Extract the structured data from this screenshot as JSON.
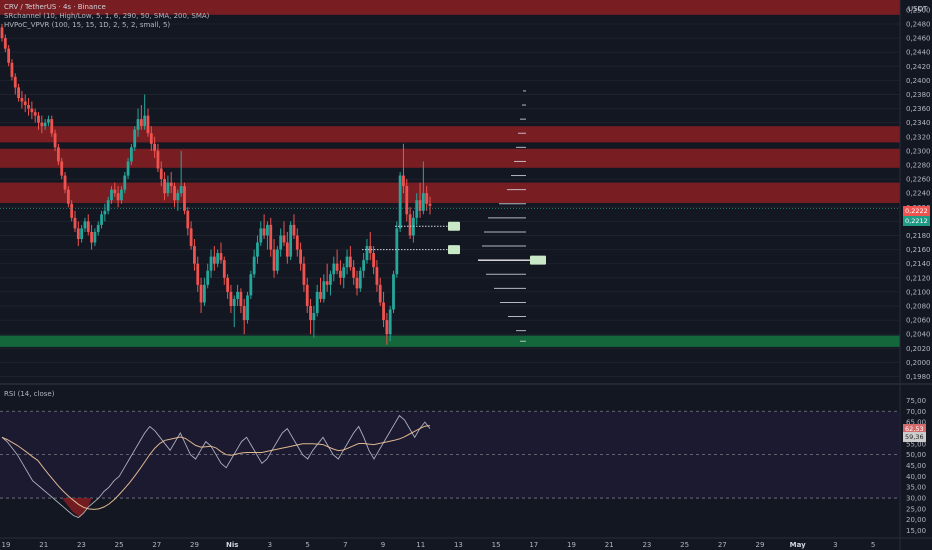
{
  "header": {
    "symbol_line": "CRV / TetherUS · 4s · Binance",
    "indicator_1": "SRchannel (10, High/Low, 5, 1, 6, 290, 50, SMA, 200, SMA)",
    "indicator_2": "HVPoC_VPVR (100, 15, 15, 1D, 2, 5, 2, small, 5)"
  },
  "currency": "USDT",
  "rsi": {
    "title": "RSI (14, close)",
    "ticks": [
      "75,00",
      "70,00",
      "65,00",
      "60,00",
      "55,00",
      "50,00",
      "45,00",
      "40,00",
      "35,00",
      "30,00",
      "25,00",
      "20,00",
      "15,00"
    ],
    "upper_band": 70,
    "lower_band": 30,
    "badge_rsi": "62,53",
    "badge_ma": "59,36"
  },
  "price_badges": {
    "last_red": "0,2222",
    "last_green": "0,2212"
  },
  "colors": {
    "background": "#131722",
    "bull": "#26a69a",
    "bear": "#ef5350",
    "resistance_zone": "#8b1e22",
    "support_zone": "#136b3d",
    "rsi_line": "#d1d4dc",
    "rsi_ma": "#f5c99a"
  },
  "chart_data": {
    "type": "candlestick",
    "y_ticks": [
      "0,2500",
      "0,2480",
      "0,2460",
      "0,2440",
      "0,2420",
      "0,2400",
      "0,2380",
      "0,2360",
      "0,2340",
      "0,2320",
      "0,2300",
      "0,2280",
      "0,2260",
      "0,2240",
      "0,2220",
      "0,2200",
      "0,2180",
      "0,2160",
      "0,2140",
      "0,2120",
      "0,2100",
      "0,2080",
      "0,2060",
      "0,2040",
      "0,2020",
      "0,2000",
      "0,1980"
    ],
    "ylim": [
      0.1975,
      0.2514
    ],
    "x_ticks": [
      "19",
      "21",
      "23",
      "25",
      "27",
      "29",
      "Nis",
      "3",
      "5",
      "7",
      "9",
      "11",
      "13",
      "15",
      "17",
      "19",
      "21",
      "23",
      "25",
      "27",
      "29",
      "May",
      "3",
      "5"
    ],
    "resistance_zones": [
      [
        0.2493,
        0.2514
      ],
      [
        0.2312,
        0.2335
      ],
      [
        0.2276,
        0.2303
      ],
      [
        0.2226,
        0.2255
      ]
    ],
    "support_zones": [
      [
        0.2022,
        0.2038
      ]
    ],
    "ohlc": [
      [
        0.2475,
        0.248,
        0.2455,
        0.246
      ],
      [
        0.246,
        0.2465,
        0.244,
        0.2445
      ],
      [
        0.2445,
        0.245,
        0.242,
        0.2425
      ],
      [
        0.2425,
        0.243,
        0.24,
        0.2405
      ],
      [
        0.2405,
        0.241,
        0.238,
        0.239
      ],
      [
        0.239,
        0.2395,
        0.237,
        0.2375
      ],
      [
        0.2375,
        0.2385,
        0.236,
        0.237
      ],
      [
        0.237,
        0.238,
        0.2355,
        0.2365
      ],
      [
        0.2365,
        0.2375,
        0.235,
        0.236
      ],
      [
        0.236,
        0.237,
        0.2345,
        0.2355
      ],
      [
        0.2355,
        0.236,
        0.234,
        0.235
      ],
      [
        0.235,
        0.2355,
        0.233,
        0.234
      ],
      [
        0.234,
        0.235,
        0.2325,
        0.2335
      ],
      [
        0.2335,
        0.2345,
        0.233,
        0.234
      ],
      [
        0.234,
        0.235,
        0.2335,
        0.2345
      ],
      [
        0.2345,
        0.235,
        0.232,
        0.2325
      ],
      [
        0.2325,
        0.233,
        0.23,
        0.2305
      ],
      [
        0.2305,
        0.231,
        0.228,
        0.2285
      ],
      [
        0.2285,
        0.229,
        0.226,
        0.2265
      ],
      [
        0.2265,
        0.227,
        0.224,
        0.2245
      ],
      [
        0.2245,
        0.225,
        0.222,
        0.2225
      ],
      [
        0.2225,
        0.223,
        0.22,
        0.2205
      ],
      [
        0.2205,
        0.2215,
        0.2185,
        0.219
      ],
      [
        0.219,
        0.22,
        0.2165,
        0.2175
      ],
      [
        0.2175,
        0.2195,
        0.217,
        0.219
      ],
      [
        0.219,
        0.2205,
        0.2185,
        0.22
      ],
      [
        0.22,
        0.221,
        0.218,
        0.2185
      ],
      [
        0.2185,
        0.2195,
        0.216,
        0.217
      ],
      [
        0.217,
        0.219,
        0.2165,
        0.2185
      ],
      [
        0.2185,
        0.22,
        0.218,
        0.2195
      ],
      [
        0.2195,
        0.2215,
        0.219,
        0.221
      ],
      [
        0.221,
        0.2225,
        0.22,
        0.2215
      ],
      [
        0.2215,
        0.2235,
        0.221,
        0.223
      ],
      [
        0.223,
        0.225,
        0.2225,
        0.2245
      ],
      [
        0.2245,
        0.2255,
        0.2235,
        0.224
      ],
      [
        0.224,
        0.225,
        0.222,
        0.223
      ],
      [
        0.223,
        0.225,
        0.2225,
        0.2245
      ],
      [
        0.2245,
        0.227,
        0.224,
        0.2265
      ],
      [
        0.2265,
        0.229,
        0.226,
        0.2285
      ],
      [
        0.2285,
        0.231,
        0.228,
        0.2305
      ],
      [
        0.2305,
        0.2335,
        0.23,
        0.233
      ],
      [
        0.233,
        0.236,
        0.232,
        0.2345
      ],
      [
        0.2345,
        0.2365,
        0.233,
        0.2335
      ],
      [
        0.2335,
        0.238,
        0.233,
        0.235
      ],
      [
        0.235,
        0.236,
        0.232,
        0.2325
      ],
      [
        0.2325,
        0.2335,
        0.23,
        0.231
      ],
      [
        0.231,
        0.232,
        0.229,
        0.23
      ],
      [
        0.23,
        0.231,
        0.227,
        0.2275
      ],
      [
        0.2275,
        0.2285,
        0.225,
        0.226
      ],
      [
        0.226,
        0.227,
        0.223,
        0.224
      ],
      [
        0.224,
        0.2265,
        0.2235,
        0.2255
      ],
      [
        0.2255,
        0.227,
        0.224,
        0.225
      ],
      [
        0.225,
        0.2255,
        0.222,
        0.223
      ],
      [
        0.223,
        0.2245,
        0.2215,
        0.224
      ],
      [
        0.224,
        0.23,
        0.2235,
        0.225
      ],
      [
        0.225,
        0.2255,
        0.221,
        0.2215
      ],
      [
        0.2215,
        0.222,
        0.218,
        0.219
      ],
      [
        0.219,
        0.22,
        0.216,
        0.2165
      ],
      [
        0.2165,
        0.2175,
        0.213,
        0.214
      ],
      [
        0.214,
        0.215,
        0.21,
        0.211
      ],
      [
        0.211,
        0.212,
        0.207,
        0.2085
      ],
      [
        0.2085,
        0.212,
        0.208,
        0.211
      ],
      [
        0.211,
        0.214,
        0.2105,
        0.213
      ],
      [
        0.213,
        0.216,
        0.212,
        0.215
      ],
      [
        0.215,
        0.2165,
        0.213,
        0.214
      ],
      [
        0.214,
        0.216,
        0.2135,
        0.2155
      ],
      [
        0.2155,
        0.217,
        0.214,
        0.2145
      ],
      [
        0.2145,
        0.215,
        0.211,
        0.212
      ],
      [
        0.212,
        0.2125,
        0.209,
        0.21
      ],
      [
        0.21,
        0.211,
        0.207,
        0.208
      ],
      [
        0.208,
        0.2095,
        0.205,
        0.209
      ],
      [
        0.209,
        0.211,
        0.208,
        0.21
      ],
      [
        0.21,
        0.2105,
        0.207,
        0.208
      ],
      [
        0.208,
        0.209,
        0.204,
        0.206
      ],
      [
        0.206,
        0.21,
        0.2055,
        0.2095
      ],
      [
        0.2095,
        0.213,
        0.209,
        0.2125
      ],
      [
        0.2125,
        0.216,
        0.212,
        0.215
      ],
      [
        0.215,
        0.218,
        0.214,
        0.217
      ],
      [
        0.217,
        0.22,
        0.2165,
        0.219
      ],
      [
        0.219,
        0.221,
        0.2175,
        0.218
      ],
      [
        0.218,
        0.22,
        0.216,
        0.2195
      ],
      [
        0.2195,
        0.2205,
        0.215,
        0.216
      ],
      [
        0.216,
        0.2175,
        0.212,
        0.213
      ],
      [
        0.213,
        0.2165,
        0.2125,
        0.216
      ],
      [
        0.216,
        0.219,
        0.215,
        0.218
      ],
      [
        0.218,
        0.22,
        0.2165,
        0.217
      ],
      [
        0.217,
        0.2185,
        0.214,
        0.215
      ],
      [
        0.215,
        0.22,
        0.2145,
        0.2195
      ],
      [
        0.2195,
        0.221,
        0.2175,
        0.218
      ],
      [
        0.218,
        0.219,
        0.215,
        0.216
      ],
      [
        0.216,
        0.217,
        0.213,
        0.214
      ],
      [
        0.214,
        0.215,
        0.21,
        0.211
      ],
      [
        0.211,
        0.212,
        0.207,
        0.208
      ],
      [
        0.208,
        0.209,
        0.204,
        0.206
      ],
      [
        0.206,
        0.208,
        0.2035,
        0.207
      ],
      [
        0.207,
        0.211,
        0.2065,
        0.21
      ],
      [
        0.21,
        0.212,
        0.2085,
        0.209
      ],
      [
        0.209,
        0.2125,
        0.2085,
        0.2115
      ],
      [
        0.2115,
        0.214,
        0.21,
        0.211
      ],
      [
        0.211,
        0.213,
        0.2095,
        0.2125
      ],
      [
        0.2125,
        0.215,
        0.2115,
        0.214
      ],
      [
        0.214,
        0.216,
        0.2125,
        0.213
      ],
      [
        0.213,
        0.2145,
        0.211,
        0.212
      ],
      [
        0.212,
        0.214,
        0.2105,
        0.2135
      ],
      [
        0.2135,
        0.216,
        0.2125,
        0.215
      ],
      [
        0.215,
        0.2165,
        0.213,
        0.2135
      ],
      [
        0.2135,
        0.2145,
        0.211,
        0.212
      ],
      [
        0.212,
        0.213,
        0.2095,
        0.2105
      ],
      [
        0.2105,
        0.2135,
        0.21,
        0.213
      ],
      [
        0.213,
        0.2155,
        0.212,
        0.2145
      ],
      [
        0.2145,
        0.2175,
        0.214,
        0.2165
      ],
      [
        0.2165,
        0.2185,
        0.2145,
        0.2155
      ],
      [
        0.2155,
        0.2165,
        0.2125,
        0.2135
      ],
      [
        0.2135,
        0.2145,
        0.21,
        0.211
      ],
      [
        0.211,
        0.212,
        0.208,
        0.2085
      ],
      [
        0.2085,
        0.21,
        0.205,
        0.206
      ],
      [
        0.206,
        0.207,
        0.2025,
        0.204
      ],
      [
        0.204,
        0.208,
        0.203,
        0.2075
      ],
      [
        0.2075,
        0.213,
        0.207,
        0.2125
      ],
      [
        0.2125,
        0.22,
        0.212,
        0.219
      ],
      [
        0.219,
        0.227,
        0.2185,
        0.2265
      ],
      [
        0.2265,
        0.231,
        0.224,
        0.225
      ],
      [
        0.225,
        0.226,
        0.22,
        0.221
      ],
      [
        0.221,
        0.222,
        0.2175,
        0.218
      ],
      [
        0.218,
        0.2215,
        0.217,
        0.2205
      ],
      [
        0.2205,
        0.224,
        0.2195,
        0.223
      ],
      [
        0.223,
        0.2255,
        0.2205,
        0.2215
      ],
      [
        0.2215,
        0.2285,
        0.221,
        0.224
      ],
      [
        0.224,
        0.225,
        0.2215,
        0.2225
      ],
      [
        0.2225,
        0.2235,
        0.221,
        0.2222
      ]
    ],
    "rsi_values": [
      58,
      56,
      53,
      50,
      46,
      42,
      38,
      36,
      34,
      32,
      30,
      28,
      26,
      24,
      22,
      21,
      23,
      26,
      28,
      30,
      33,
      35,
      38,
      40,
      44,
      48,
      52,
      56,
      60,
      63,
      61,
      58,
      55,
      52,
      56,
      60,
      55,
      50,
      48,
      52,
      56,
      54,
      50,
      46,
      44,
      48,
      52,
      56,
      58,
      54,
      50,
      46,
      48,
      52,
      56,
      60,
      62,
      58,
      54,
      50,
      48,
      52,
      55,
      58,
      54,
      50,
      48,
      52,
      56,
      60,
      63,
      58,
      52,
      48,
      52,
      56,
      60,
      64,
      68,
      66,
      62,
      58,
      62,
      65,
      62
    ]
  }
}
